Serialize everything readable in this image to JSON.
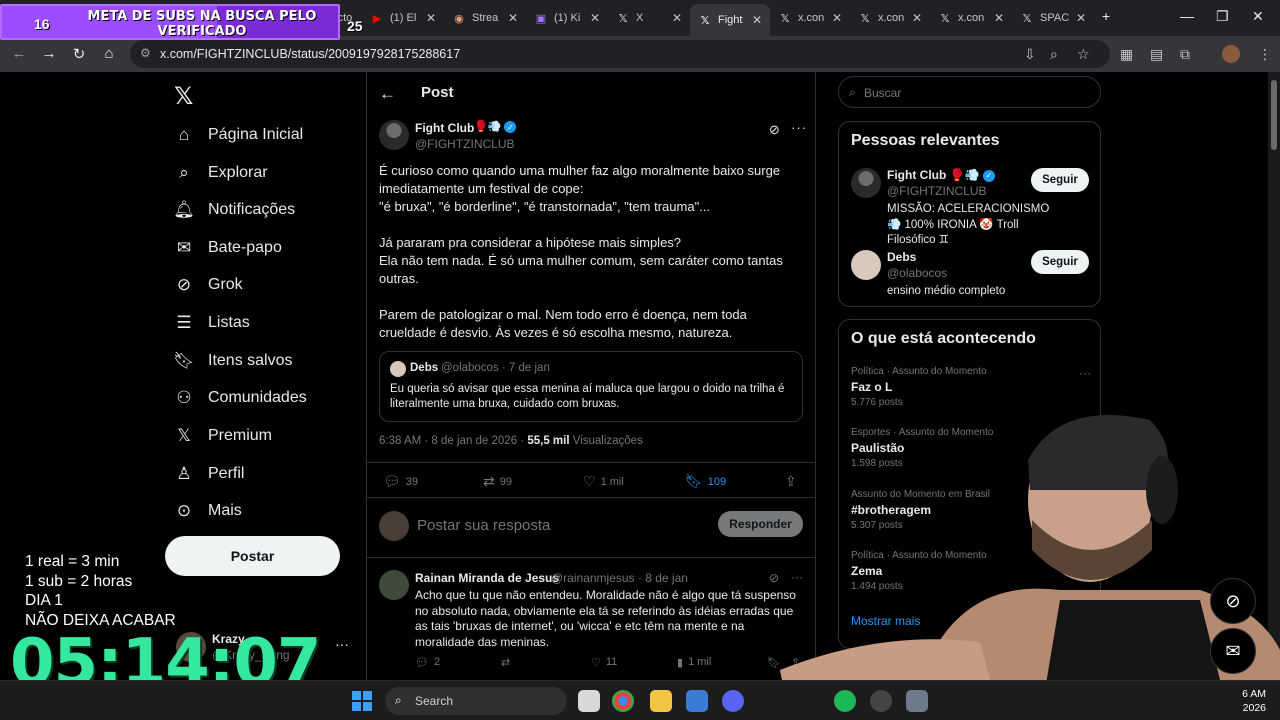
{
  "overlay": {
    "subs_count": "16",
    "subs_goal": "25",
    "subs_title": "META DE SUBS NA BUSCA PELO VERIFICADO",
    "subs_progress": 0.64,
    "notes": [
      "1 real = 3 min",
      "1 sub = 2 horas",
      "DIA 1",
      "NÃO DEIXA ACABAR"
    ],
    "timer": "05:14:07"
  },
  "browser": {
    "tabs": [
      {
        "label": "Victo",
        "icon": "tab-favicon"
      },
      {
        "label": "(1) El",
        "icon": "youtube-icon"
      },
      {
        "label": "Strea",
        "icon": "stream-icon"
      },
      {
        "label": "(1) Ki",
        "icon": "twitch-icon"
      },
      {
        "label": "X",
        "icon": "x-icon"
      },
      {
        "label": "Fight",
        "icon": "x-icon",
        "active": true
      },
      {
        "label": "x.con",
        "icon": "x-icon"
      },
      {
        "label": "x.con",
        "icon": "x-icon"
      },
      {
        "label": "x.con",
        "icon": "x-icon"
      },
      {
        "label": "SPAC",
        "icon": "x-icon"
      }
    ],
    "url": "x.com/FIGHTZINCLUB/status/2009197928175288617"
  },
  "nav": {
    "items": [
      {
        "label": "Página Inicial",
        "icon": "home-icon"
      },
      {
        "label": "Explorar",
        "icon": "search-icon"
      },
      {
        "label": "Notificações",
        "icon": "bell-icon"
      },
      {
        "label": "Bate-papo",
        "icon": "mail-icon"
      },
      {
        "label": "Grok",
        "icon": "grok-icon"
      },
      {
        "label": "Listas",
        "icon": "list-icon"
      },
      {
        "label": "Itens salvos",
        "icon": "bookmark-icon"
      },
      {
        "label": "Comunidades",
        "icon": "communities-icon"
      },
      {
        "label": "Premium",
        "icon": "x-icon"
      },
      {
        "label": "Perfil",
        "icon": "profile-icon"
      },
      {
        "label": "Mais",
        "icon": "more-circle-icon"
      }
    ],
    "post_button": "Postar",
    "account_name": "Krazy",
    "account_handle": "@Krazy_Ryng"
  },
  "main": {
    "header": "Post",
    "post": {
      "author": "Fight Club",
      "handle": "@FIGHTZINCLUB",
      "body": "É curioso como quando uma mulher faz algo moralmente baixo surge imediatamente um festival de cope:\n\"é bruxa\", \"é borderline\", \"é transtornada\", \"tem trauma\"...\n\nJá pararam pra considerar a hipótese mais simples?\nEla não tem nada. É só uma mulher comum, sem caráter como tantas outras.\n\nParem de patologizar o mal. Nem todo erro é doença, nem toda crueldade é desvio. Às vezes é só escolha mesmo, natureza.",
      "quote": {
        "name": "Debs",
        "meta": "@olabocos · 7 de jan",
        "text": "Eu queria só avisar que essa menina aí maluca que largou o doido na trilha é literalmente uma bruxa, cuidado com bruxas."
      },
      "time": "6:38 AM · 8 de jan de 2026 · ",
      "views": "55,5 mil",
      "views_label": " Visualizações",
      "replies": "39",
      "reposts": "99",
      "likes": "1 mil",
      "bookmarks": "109"
    },
    "reply_placeholder": "Postar sua resposta",
    "reply_button": "Responder",
    "reply": {
      "name": "Rainan Miranda de Jesus",
      "meta": "@rainanmjesus · 8 de jan",
      "text": "Acho que tu que não entendeu. Moralidade não é algo que tá suspenso no absoluto nada, obviamente ela tá se referindo às idéias erradas que as tais 'bruxas de internet', ou 'wicca' e etc têm na mente e na moralidade das meninas.",
      "replies": "2",
      "likes": "11",
      "views": "1 mil"
    }
  },
  "right": {
    "search_placeholder": "Buscar",
    "people_title": "Pessoas relevantes",
    "people": [
      {
        "name": "Fight Club",
        "handle": "@FIGHTZINCLUB",
        "bio": "MISSÃO: ACELERACIONISMO 💨 100% IRONIA 🤡 Troll Filosófico ♊",
        "follow": "Seguir"
      },
      {
        "name": "Debs",
        "handle": "@olabocos",
        "bio": "ensino médio completo",
        "follow": "Seguir"
      }
    ],
    "trends_title": "O que está acontecendo",
    "trends": [
      {
        "context": "Política · Assunto do Momento",
        "name": "Faz o L",
        "posts": "5.776 posts"
      },
      {
        "context": "Esportes · Assunto do Momento",
        "name": "Paulistão",
        "posts": "1.598 posts"
      },
      {
        "context": "Assunto do Momento em Brasil",
        "name": "#brotheragem",
        "posts": "5.307 posts"
      },
      {
        "context": "Política · Assunto do Momento",
        "name": "Zema",
        "posts": "1.494 posts"
      }
    ],
    "show_more": "Mostrar mais"
  },
  "taskbar": {
    "search": "Search",
    "time": "6 AM",
    "date": "2026"
  },
  "colors": {
    "accent": "#1d9bf0",
    "timer": "#34e89e",
    "banner": "#7b2bd6"
  }
}
